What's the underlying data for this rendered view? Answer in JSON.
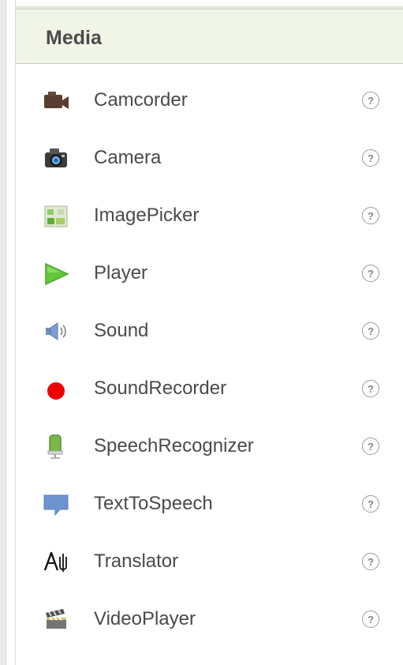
{
  "section": {
    "title": "Media"
  },
  "items": [
    {
      "label": "Camcorder",
      "icon": "camcorder-icon",
      "help": "?"
    },
    {
      "label": "Camera",
      "icon": "camera-icon",
      "help": "?"
    },
    {
      "label": "ImagePicker",
      "icon": "image-picker-icon",
      "help": "?"
    },
    {
      "label": "Player",
      "icon": "player-icon",
      "help": "?"
    },
    {
      "label": "Sound",
      "icon": "sound-icon",
      "help": "?"
    },
    {
      "label": "SoundRecorder",
      "icon": "sound-recorder-icon",
      "help": "?"
    },
    {
      "label": "SpeechRecognizer",
      "icon": "speech-recognizer-icon",
      "help": "?"
    },
    {
      "label": "TextToSpeech",
      "icon": "text-to-speech-icon",
      "help": "?"
    },
    {
      "label": "Translator",
      "icon": "translator-icon",
      "help": "?"
    },
    {
      "label": "VideoPlayer",
      "icon": "video-player-icon",
      "help": "?"
    }
  ],
  "colors": {
    "header_background": "#f1f5e8",
    "header_border": "#c7ccb9",
    "text": "#4a4a4a",
    "recorder_red": "#ee0000",
    "player_green": "#62c83a"
  }
}
